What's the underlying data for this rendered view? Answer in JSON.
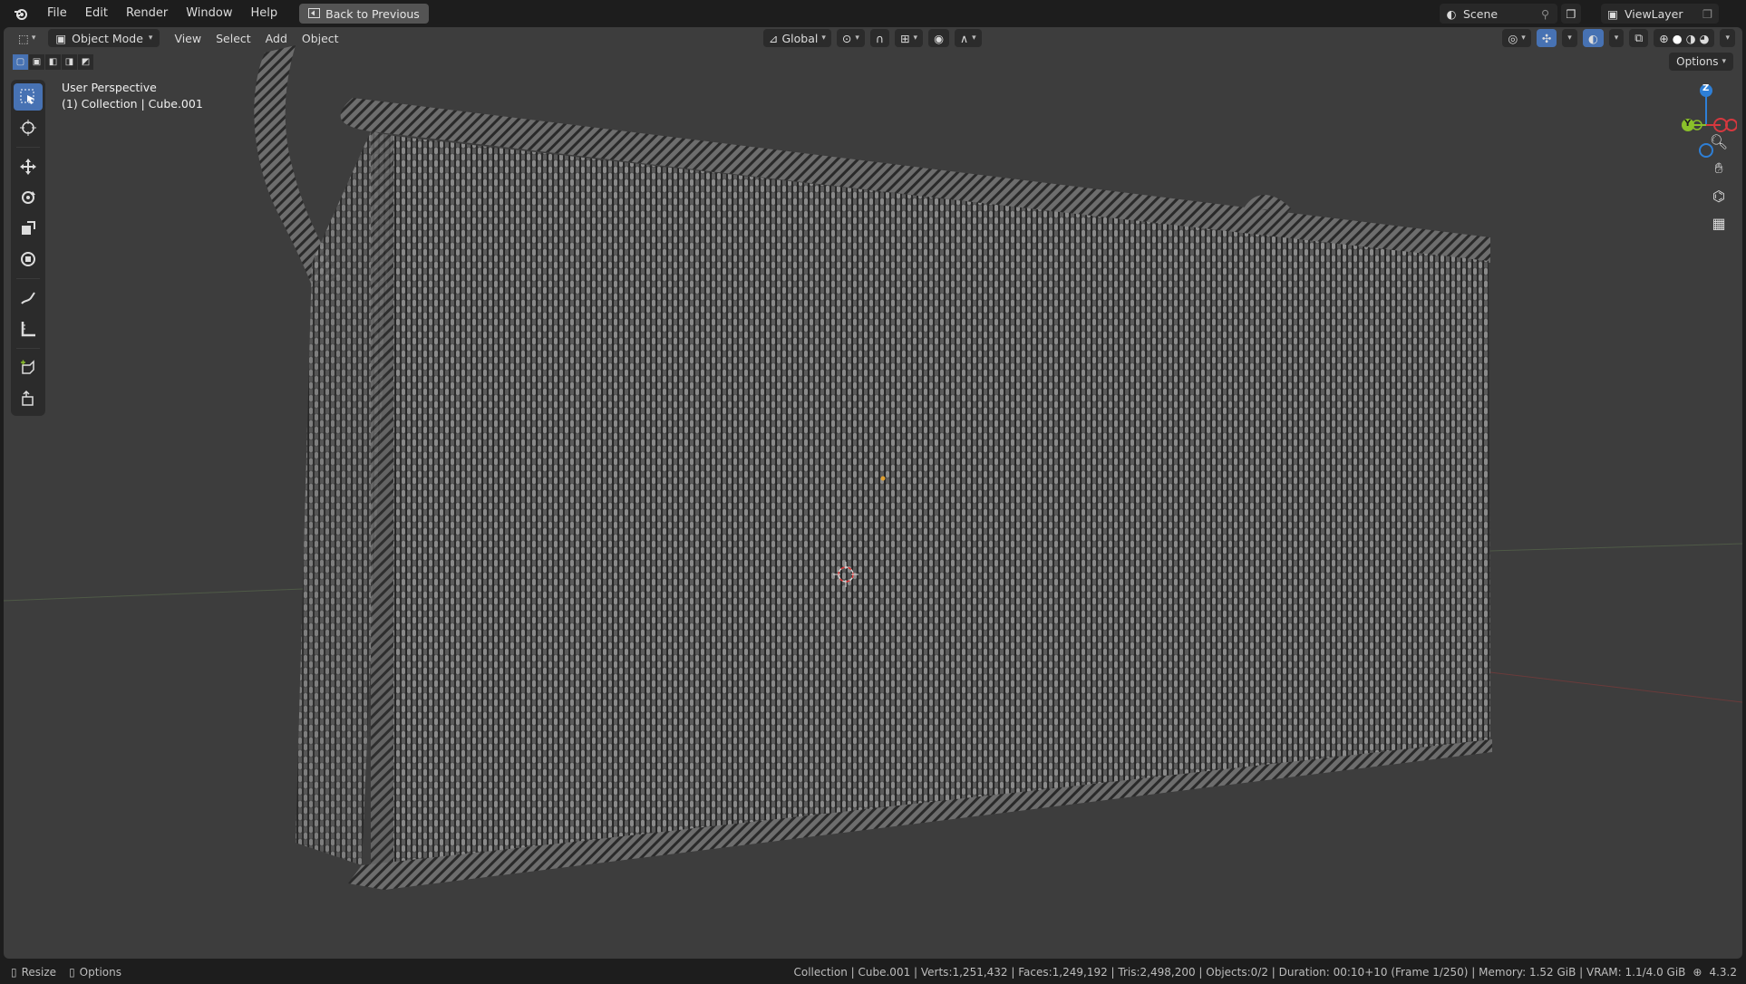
{
  "menu": [
    "File",
    "Edit",
    "Render",
    "Window",
    "Help"
  ],
  "back_button": "Back to Previous",
  "scene": {
    "label": "Scene"
  },
  "view_layer": {
    "label": "ViewLayer"
  },
  "header": {
    "mode": "Object Mode",
    "menus": [
      "View",
      "Select",
      "Add",
      "Object"
    ],
    "orientation": "Global",
    "options": "Options"
  },
  "viewport": {
    "perspective": "User Perspective",
    "collection": "(1) Collection | Cube.001"
  },
  "gizmo": {
    "z": "Z",
    "y": "Y"
  },
  "status": {
    "left": [
      "Resize",
      "Options"
    ],
    "stats": "Collection | Cube.001 | Verts:1,251,432 | Faces:1,249,192 | Tris:2,498,200 | Objects:0/2 | Duration: 00:10+10 (Frame 1/250) | Memory: 1.52 GiB | VRAM: 1.1/4.0 GiB",
    "version": "4.3.2"
  },
  "colors": {
    "accent": "#4772b3",
    "viewport_bg": "#3d3d3d",
    "axis_x": "#d6383f",
    "axis_y": "#8ac02a",
    "axis_z": "#2e7fd6"
  },
  "icons": [
    "blender-logo",
    "editor-type-icon",
    "cursor-tool-icon",
    "move-tool-icon",
    "rotate-tool-icon",
    "scale-tool-icon",
    "transform-tool-icon",
    "annotate-tool-icon",
    "measure-tool-icon",
    "add-cube-tool-icon",
    "zoom-icon",
    "hand-icon",
    "camera-icon",
    "grid-icon"
  ]
}
